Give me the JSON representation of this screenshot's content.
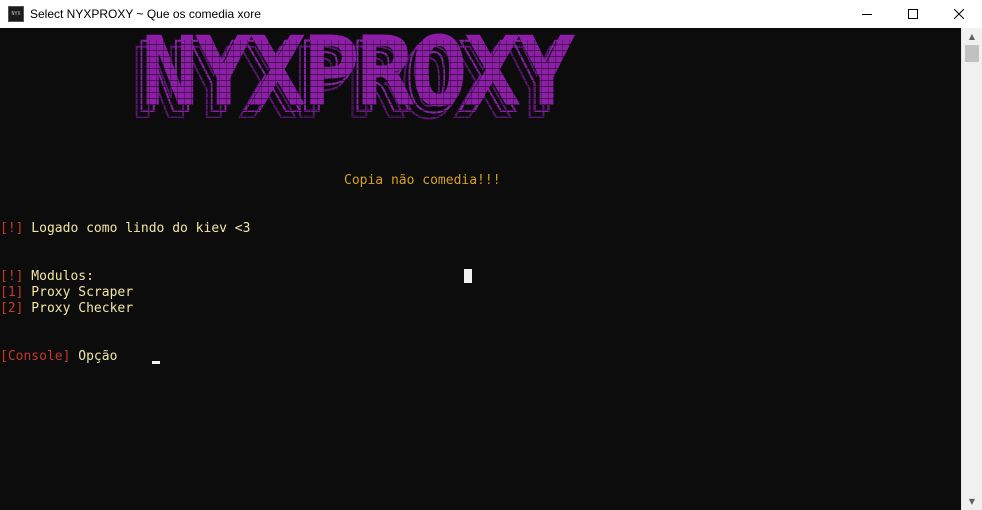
{
  "window": {
    "title": "Select NYXPROXY ~ Que os comedia xore",
    "icon_label": "NYX",
    "controls": {
      "minimize": "minimize-icon",
      "maximize": "maximize-icon",
      "close": "close-icon"
    }
  },
  "console": {
    "banner": "NYXPROXY",
    "subtitle": "Copia não comedia!!!",
    "status": {
      "tag": "[!]",
      "text": " Logado como lindo do kiev <3"
    },
    "modules_header": {
      "tag": "[!]",
      "text": " Modulos:"
    },
    "modules": [
      {
        "tag": "[1]",
        "text": " Proxy Scraper"
      },
      {
        "tag": "[2]",
        "text": " Proxy Checker"
      }
    ],
    "prompt": {
      "tag": "[Console]",
      "text": " Opção"
    }
  },
  "colors": {
    "background": "#0c0c0c",
    "banner": "#8e1ea8",
    "tag": "#c0392b",
    "text": "#f2e6a6",
    "subtitle": "#d7a023"
  }
}
